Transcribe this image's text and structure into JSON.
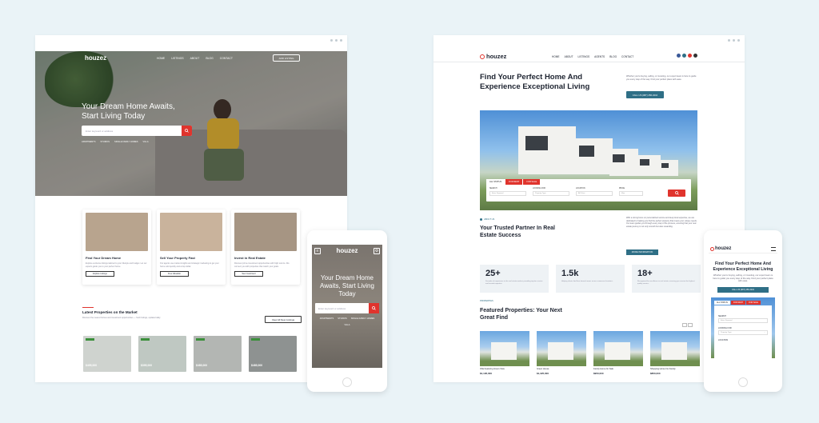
{
  "left": {
    "logo": "houzez",
    "nav": [
      "HOME",
      "LISTINGS",
      "ABOUT",
      "BLOG",
      "CONTACT"
    ],
    "add_listing": "ADD LISTING",
    "hero_title": "Your Dream Home Awaits, Start Living Today",
    "search_placeholder": "Enter keyword or address",
    "chips": [
      "APARTMENTS",
      "STUDIOS",
      "SINGLE FAMILY HOMES",
      "VILLA"
    ],
    "cards": [
      {
        "title": "Find Your Dream Home",
        "text": "Explore exclusive listings tailored to your lifestyle and budget. Let our experts guide you to your perfect home.",
        "button": "Explore Listings",
        "color": "#b8a48e"
      },
      {
        "title": "Sell Your Property Fast",
        "text": "Our agents use market insights and strategic marketing to get your home sold quickly and at top dollar.",
        "button": "Free Valuation",
        "color": "#c9b39c"
      },
      {
        "title": "Invest in Real Estate",
        "text": "Discover prime investment opportunities with high returns. We connect you with properties that match your goals.",
        "button": "See Investment",
        "color": "#a69583"
      }
    ],
    "latest_title": "Latest Properties on the Market",
    "latest_sub": "Discover the newest homes and investment opportunities — fresh listings, updated daily.",
    "view_all": "View All New Listings",
    "props": [
      {
        "price": "$495,000",
        "color": "#cfd3cf"
      },
      {
        "price": "$395,000",
        "color": "#bfc8c2"
      },
      {
        "price": "$485,000",
        "color": "#b3b6b3"
      },
      {
        "price": "$485,000",
        "color": "#8e9291"
      }
    ]
  },
  "phone1": {
    "logo": "houzez",
    "title": "Your Dream Home Awaits, Start Living Today",
    "search_placeholder": "Enter keyword or address",
    "chips": [
      "APARTMENTS",
      "STUDIOS",
      "SINGLE FAMILY HOMES",
      "VILLA"
    ]
  },
  "right": {
    "logo": "houzez",
    "nav": [
      "HOME",
      "ABOUT",
      "LISTINGS",
      "AGENTS",
      "BLOG",
      "CONTACT"
    ],
    "social_colors": [
      "#3b5998",
      "#2f6f86",
      "#e0342d",
      "#333333"
    ],
    "headline": "Find Your Perfect Home And Experience Exceptional Living",
    "intro": "Whether you're buying, selling, or investing, our expert team is here to guide you every step of the way. Find your perfect place with ease.",
    "call": "CALL US (987) 456-3210",
    "tabs": [
      "ALL STATUS",
      "FOR RENT",
      "FOR SALE"
    ],
    "fields": [
      {
        "label": "SEARCH",
        "value": "Enter Keyword"
      },
      {
        "label": "LOOKING FOR",
        "value": "Property Type"
      },
      {
        "label": "LOCATION",
        "value": "All Cities"
      },
      {
        "label": "PRICE",
        "value": "Max"
      }
    ],
    "about_kicker": "ABOUT US",
    "about_title": "Your Trusted Partner In Real Estate Success",
    "about_text": "With a strong focus on personalized service and deep local expertise, we are dedicated to helping you find the perfect property that meets your unique needs. Our team guides you through every step of the process, ensuring that your real estate journey is not only smooth but also rewarding.",
    "more_info": "MORE INFORMATION",
    "stats": [
      {
        "value": "25+",
        "text": "Decades of experience in the real estate market, providing top-tier service and trusted expertise."
      },
      {
        "value": "1.5k",
        "text": "Helping clients find their dream homes across numerous locations."
      },
      {
        "value": "18+",
        "text": "Recognized for excellence in real estate, ensuring you receive the highest quality service."
      }
    ],
    "featured_kicker": "PROPERTIES",
    "featured_title": "Featured Properties: Your Next Great Find",
    "props": [
      {
        "name": "Villa Featuring Green View",
        "price": "$1,195,000"
      },
      {
        "name": "Green House",
        "price": "$1,325,000"
      },
      {
        "name": "Family Home for Sale",
        "price": "$950,000"
      },
      {
        "name": "Shopping Home For Family",
        "price": "$850,000"
      }
    ]
  },
  "phone2": {
    "logo": "houzez",
    "title": "Find Your Perfect Home And Experience Exceptional Living",
    "text": "Whether you're buying, selling, or investing, our expert team is here to guide you every step of the way. Find your perfect place with ease.",
    "call": "CALL US (987) 456-3210",
    "tabs": [
      "ALL STATUS",
      "FOR RENT",
      "FOR SALE"
    ],
    "search_label": "SEARCH",
    "search_value": "Enter Keyword",
    "looking_label": "LOOKING FOR",
    "looking_value": "Property Type",
    "location_label": "LOCATION"
  }
}
